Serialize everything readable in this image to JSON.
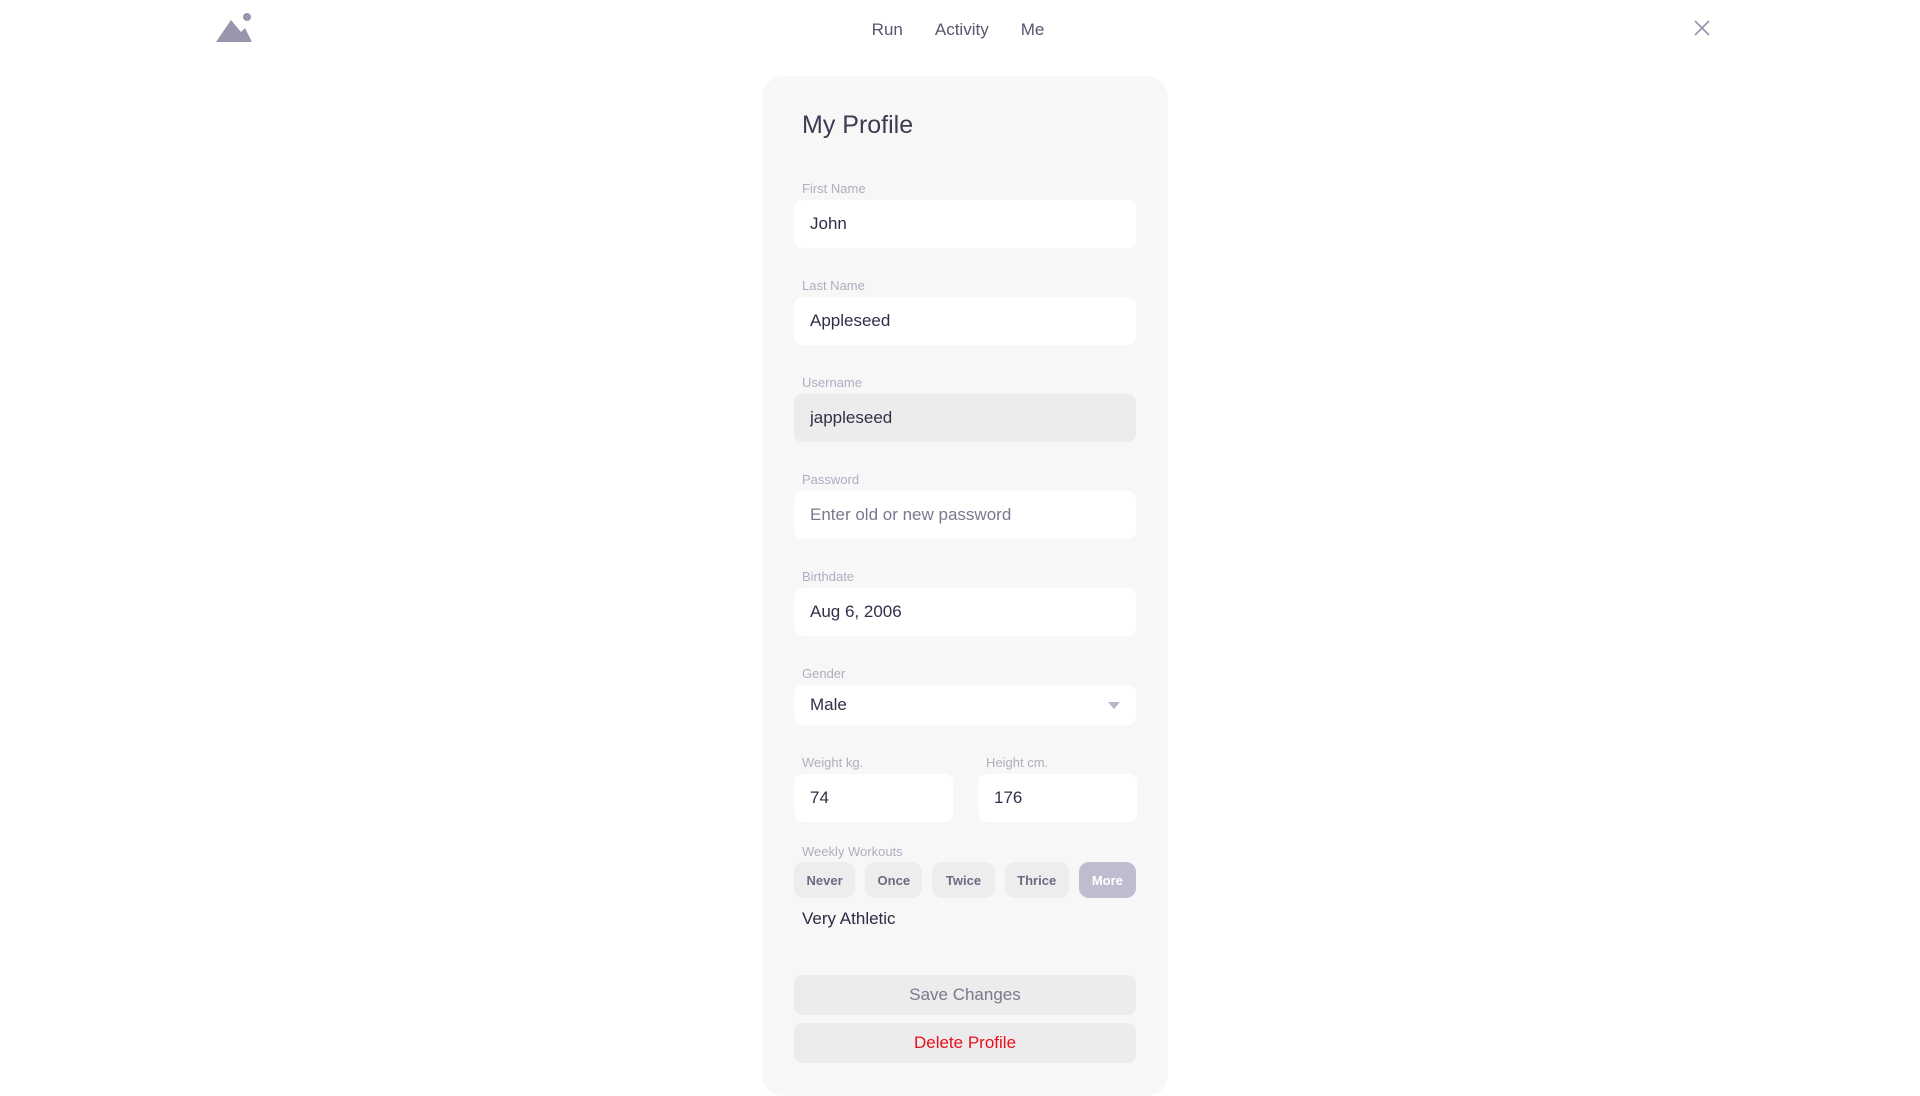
{
  "nav": {
    "items": [
      "Run",
      "Activity",
      "Me"
    ]
  },
  "profile": {
    "title": "My Profile",
    "first_name": {
      "label": "First Name",
      "value": "John"
    },
    "last_name": {
      "label": "Last Name",
      "value": "Appleseed"
    },
    "username": {
      "label": "Username",
      "value": "jappleseed"
    },
    "password": {
      "label": "Password",
      "placeholder": "Enter old or new password"
    },
    "birthdate": {
      "label": "Birthdate",
      "value": "Aug 6, 2006"
    },
    "gender": {
      "label": "Gender",
      "value": "Male"
    },
    "weight": {
      "label": "Weight kg.",
      "value": "74"
    },
    "height": {
      "label": "Height cm.",
      "value": "176"
    },
    "weekly_workouts": {
      "label": "Weekly Workouts",
      "options": [
        "Never",
        "Once",
        "Twice",
        "Thrice",
        "More"
      ],
      "selected": "More",
      "level_text": "Very Athletic"
    },
    "save_label": "Save Changes",
    "delete_label": "Delete Profile"
  },
  "colors": {
    "accent": "#bfbcd0",
    "danger": "#e8101b",
    "card_bg": "#f7f7f7",
    "text": "#3a3550"
  },
  "icons": {
    "logo": "mountain-icon",
    "close": "close-icon",
    "dropdown": "chevron-down-icon"
  }
}
